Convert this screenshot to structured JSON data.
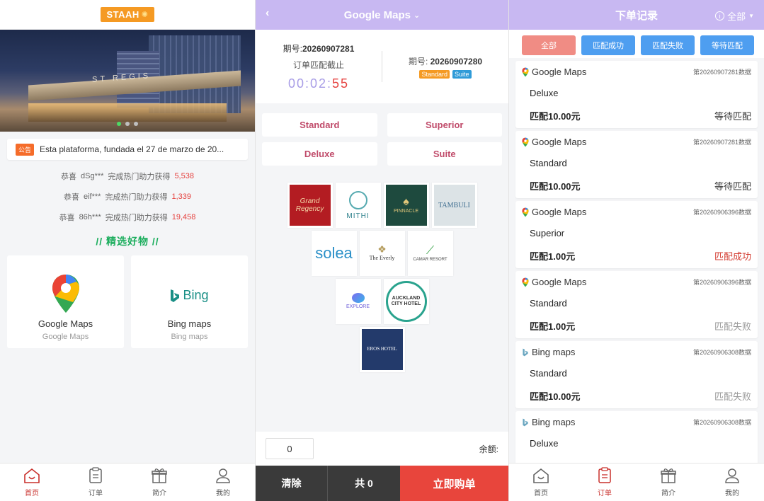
{
  "home": {
    "logo_text": "STAAH",
    "notice_badge": "公告",
    "notice_text": "Esta plataforma, fundada el 27 de marzo de 20...",
    "winners": [
      {
        "prefix": "恭喜",
        "user": "dSg***",
        "msg": "完成热门助力获得",
        "amount": "5,538"
      },
      {
        "prefix": "恭喜",
        "user": "eif***",
        "msg": "完成热门助力获得",
        "amount": "1,339"
      },
      {
        "prefix": "恭喜",
        "user": "86h***",
        "msg": "完成热门助力获得",
        "amount": "19,458"
      }
    ],
    "section_title": "// 精选好物 //",
    "products": [
      {
        "name": "Google Maps",
        "sub": "Google Maps",
        "icon": "google-maps-icon"
      },
      {
        "name": "Bing maps",
        "sub": "Bing maps",
        "icon": "bing-icon",
        "logo_text": "Bing"
      }
    ],
    "tabs": [
      {
        "label": "首页",
        "icon": "home-icon",
        "active": true
      },
      {
        "label": "订单",
        "icon": "order-icon",
        "active": false
      },
      {
        "label": "简介",
        "icon": "gift-icon",
        "active": false
      },
      {
        "label": "我的",
        "icon": "user-icon",
        "active": false
      }
    ]
  },
  "match": {
    "back": "‹",
    "title": "Google Maps",
    "current_period_label": "期号:",
    "current_period": "20260907281",
    "deadline_label": "订单匹配截止",
    "timer_main": "00:02:",
    "timer_sec": "55",
    "prev_period_label": "期号:",
    "prev_period": "20260907280",
    "prev_tags": [
      "Standard",
      "Suite"
    ],
    "options": [
      "Standard",
      "Superior",
      "Deluxe",
      "Suite"
    ],
    "hotel_logos": [
      [
        "Grand Regency",
        "MITHI",
        "PINNACLE",
        "TAMBULI"
      ],
      [
        "solea",
        "The Everly",
        "CAMAR RESORT"
      ],
      [
        "EXPLORE",
        "AUCKLAND CITY HOTEL"
      ],
      [
        "EROS HOTEL"
      ]
    ],
    "quantity": "0",
    "balance_label": "余额:",
    "clear_label": "清除",
    "total_label": "共 0",
    "buy_label": "立即购单"
  },
  "orders": {
    "title": "下单记录",
    "filter_label": "全部",
    "filter_buttons": [
      "全部",
      "匹配成功",
      "匹配失败",
      "等待匹配"
    ],
    "list": [
      {
        "app": "Google Maps",
        "icon": "google-maps-pin-icon",
        "period": "第20260907281数据",
        "room": "Deluxe",
        "amount": "匹配10.00元",
        "status": "等待匹配",
        "status_type": "wait"
      },
      {
        "app": "Google Maps",
        "icon": "google-maps-pin-icon",
        "period": "第20260907281数据",
        "room": "Standard",
        "amount": "匹配10.00元",
        "status": "等待匹配",
        "status_type": "wait"
      },
      {
        "app": "Google Maps",
        "icon": "google-maps-pin-icon",
        "period": "第20260906396数据",
        "room": "Superior",
        "amount": "匹配1.00元",
        "status": "匹配成功",
        "status_type": "ok"
      },
      {
        "app": "Google Maps",
        "icon": "google-maps-pin-icon",
        "period": "第20260906396数据",
        "room": "Standard",
        "amount": "匹配1.00元",
        "status": "匹配失败",
        "status_type": "fail"
      },
      {
        "app": "Bing maps",
        "icon": "bing-icon",
        "period": "第20260906308数据",
        "room": "Standard",
        "amount": "匹配10.00元",
        "status": "匹配失败",
        "status_type": "fail"
      },
      {
        "app": "Bing maps",
        "icon": "bing-icon",
        "period": "第20260906308数据",
        "room": "Deluxe",
        "amount": "",
        "status": "",
        "status_type": "none"
      }
    ],
    "tabs": [
      {
        "label": "首页",
        "icon": "home-icon",
        "active": false
      },
      {
        "label": "订单",
        "icon": "order-icon",
        "active": true
      },
      {
        "label": "简介",
        "icon": "gift-icon",
        "active": false
      },
      {
        "label": "我的",
        "icon": "user-icon",
        "active": false
      }
    ]
  }
}
